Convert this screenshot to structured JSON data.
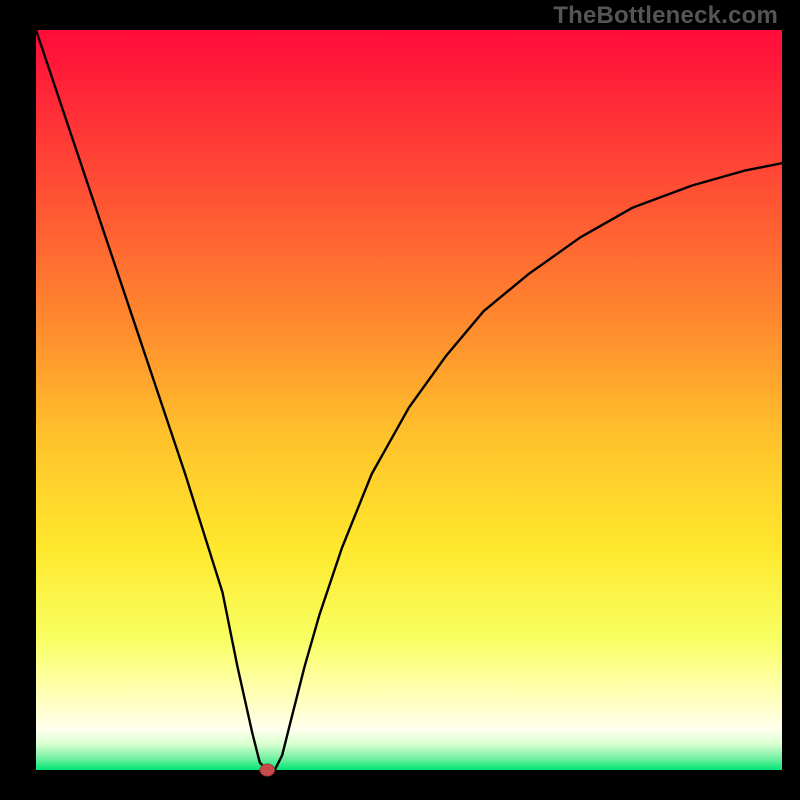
{
  "watermark": "TheBottleneck.com",
  "layout": {
    "outer_w": 800,
    "outer_h": 800,
    "margin_left": 36,
    "margin_right": 18,
    "margin_top": 30,
    "margin_bottom": 30
  },
  "chart_data": {
    "type": "line",
    "title": "",
    "xlabel": "",
    "ylabel": "",
    "xlim": [
      0,
      100
    ],
    "ylim": [
      0,
      100
    ],
    "grid": false,
    "legend": null,
    "background": "vertical_gradient",
    "gradient_stops": [
      {
        "offset": 0.0,
        "color": "#ff0b3a"
      },
      {
        "offset": 0.2,
        "color": "#ff4a35"
      },
      {
        "offset": 0.4,
        "color": "#ff8b2e"
      },
      {
        "offset": 0.55,
        "color": "#ffc22b"
      },
      {
        "offset": 0.7,
        "color": "#ffe82d"
      },
      {
        "offset": 0.82,
        "color": "#f8ff60"
      },
      {
        "offset": 0.9,
        "color": "#ffffb8"
      },
      {
        "offset": 0.945,
        "color": "#ffffee"
      },
      {
        "offset": 0.965,
        "color": "#d9ffd0"
      },
      {
        "offset": 0.985,
        "color": "#6ff0a0"
      },
      {
        "offset": 1.0,
        "color": "#00e676"
      }
    ],
    "series": [
      {
        "name": "curve",
        "x": [
          0,
          5,
          10,
          15,
          20,
          25,
          27,
          29,
          30,
          31,
          32,
          33,
          34,
          36,
          38,
          41,
          45,
          50,
          55,
          60,
          66,
          73,
          80,
          88,
          95,
          100
        ],
        "y": [
          100,
          85,
          70,
          55,
          40,
          24,
          14,
          5,
          1,
          0,
          0,
          2,
          6,
          14,
          21,
          30,
          40,
          49,
          56,
          62,
          67,
          72,
          76,
          79,
          81,
          82
        ]
      }
    ],
    "marker": {
      "x": 31,
      "y": 0,
      "r": 6
    }
  }
}
